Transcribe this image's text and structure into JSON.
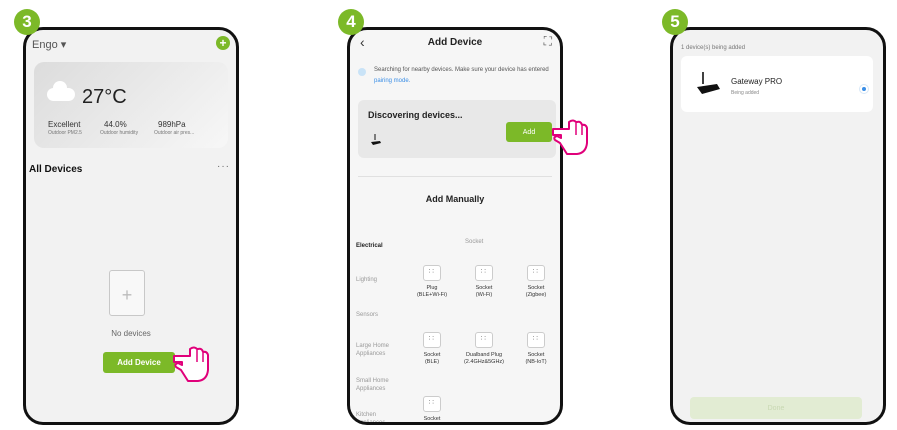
{
  "steps": [
    "3",
    "4",
    "5"
  ],
  "screen3": {
    "account": "Engo ▾",
    "temperature": "27°C",
    "air_quality": "Excellent",
    "air_label": "Outdoor PM2.5",
    "humidity": "44.0%",
    "humidity_label": "Outdoor humidity",
    "pressure": "989hPa",
    "pressure_label": "Outdoor air pres...",
    "section_title": "All Devices",
    "more": "···",
    "empty_text": "No devices",
    "add_button": "Add Device"
  },
  "screen4": {
    "back": "‹",
    "title": "Add Device",
    "info_text": "Searching for nearby devices. Make sure your device has entered",
    "info_link": "pairing mode.",
    "discovering": "Discovering devices...",
    "add_button": "Add",
    "manual_title": "Add Manually",
    "categories": [
      "Electrical",
      "Lighting",
      "Sensors",
      "Large Home Appliances",
      "Small Home Appliances",
      "Kitchen Appliances"
    ],
    "group_header": "Socket",
    "devices": [
      {
        "label": "Plug\n(BLE+Wi-Fi)"
      },
      {
        "label": "Socket\n(Wi-Fi)"
      },
      {
        "label": "Socket\n(Zigbee)"
      },
      {
        "label": "Socket\n(BLE)"
      },
      {
        "label": "Dualband Plug\n(2.4GHz&5GHz)"
      },
      {
        "label": "Socket\n(NB-IoT)"
      },
      {
        "label": "Socket"
      }
    ]
  },
  "screen5": {
    "header": "1 device(s) being added",
    "device_name": "Gateway PRO",
    "device_status": "Being added",
    "done_button": "Done"
  },
  "colors": {
    "accent": "#7cb928",
    "link": "#3a8ee6"
  }
}
